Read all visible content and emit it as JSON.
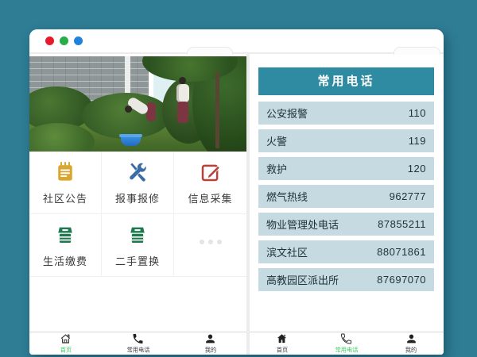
{
  "theme": {
    "desktop_background": "#2e7d95",
    "header_bar": "#2f8ba2",
    "list_row_bg": "#c6dbe1",
    "list_text": "#1d3138",
    "active_tab_green": "#3ecd63",
    "inactive_tab_text": "#3a3a3a",
    "icon_gold": "#d9a62e",
    "icon_blue": "#3b6ca5",
    "icon_red": "#b5433c",
    "icon_green": "#1e7a4e",
    "traffic_lights": [
      "#e8192c",
      "#28ad4a",
      "#2182dd"
    ]
  },
  "left_screen": {
    "hero_image": "community-workers-gardening-photo",
    "grid_items": [
      {
        "label": "社区公告",
        "icon": "notepad-icon"
      },
      {
        "label": "报事报修",
        "icon": "repair-tools-icon"
      },
      {
        "label": "信息采集",
        "icon": "edit-square-icon"
      },
      {
        "label": "生活缴费",
        "icon": "payment-box-icon"
      },
      {
        "label": "二手置换",
        "icon": "exchange-box-icon"
      },
      {
        "label": "",
        "icon": "more-dots-icon"
      }
    ],
    "tabbar": {
      "items": [
        {
          "label": "首页",
          "icon": "home-icon"
        },
        {
          "label": "常用电话",
          "icon": "phone-icon"
        },
        {
          "label": "我的",
          "icon": "user-icon"
        }
      ],
      "active": "首页"
    }
  },
  "right_screen": {
    "header_title": "常用电话",
    "phone_list": [
      {
        "name": "公安报警",
        "number": "110"
      },
      {
        "name": "火警",
        "number": "119"
      },
      {
        "name": "救护",
        "number": "120"
      },
      {
        "name": "燃气热线",
        "number": "962777"
      },
      {
        "name": "物业管理处电话",
        "number": "87855211"
      },
      {
        "name": "滨文社区",
        "number": "88071861"
      },
      {
        "name": "高教园区派出所",
        "number": "87697070"
      }
    ],
    "tabbar": {
      "items": [
        {
          "label": "首页",
          "icon": "home-icon"
        },
        {
          "label": "常用电话",
          "icon": "phone-icon"
        },
        {
          "label": "我的",
          "icon": "user-icon"
        }
      ],
      "active": "常用电话"
    }
  }
}
